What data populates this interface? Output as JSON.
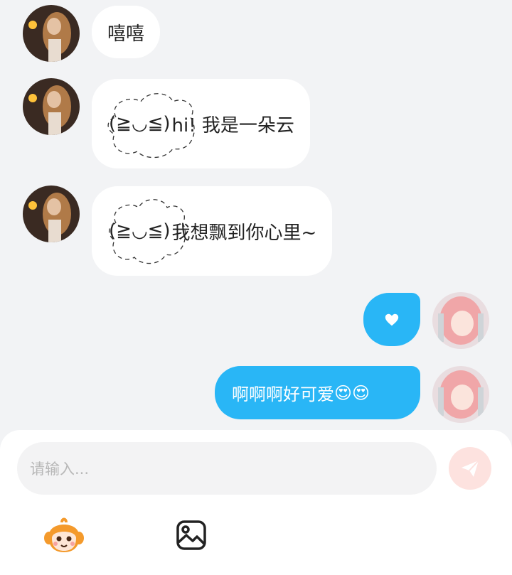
{
  "messages": [
    {
      "side": "left",
      "text": "嘻嘻"
    },
    {
      "side": "left",
      "kaomoji": "(≧◡≦)",
      "text": "hi! 我是一朵云"
    },
    {
      "side": "left",
      "kaomoji": "(≧◡≦)",
      "text": "我想飘到你心里~"
    },
    {
      "side": "right",
      "icon": "heart-icon"
    },
    {
      "side": "right",
      "text": "啊啊啊好可爱",
      "emoji": "😍😍"
    }
  ],
  "input": {
    "placeholder": "请输入..."
  },
  "colors": {
    "background": "#f2f3f5",
    "incoming_bubble": "#ffffff",
    "outgoing_bubble": "#29b6f6",
    "send_button": "#fde2df",
    "send_icon": "#ffffff"
  },
  "toolbar": {
    "icons": [
      "mascot-emoji-icon",
      "image-icon"
    ]
  }
}
